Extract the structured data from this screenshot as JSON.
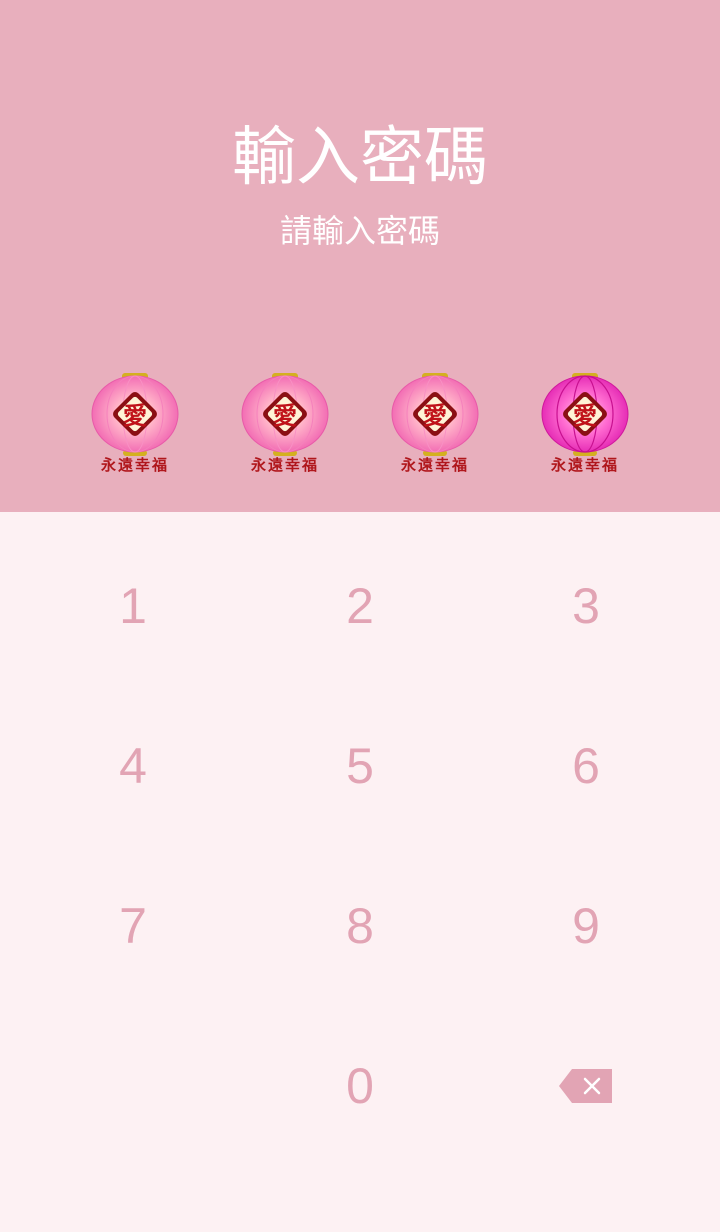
{
  "header": {
    "title": "輸入密碼",
    "subtitle": "請輸入密碼",
    "background_color": "#e8afbd"
  },
  "pin_indicators": [
    {
      "icon": "lantern-icon",
      "emblem": "愛",
      "caption": "永遠幸福",
      "filled": false
    },
    {
      "icon": "lantern-icon",
      "emblem": "愛",
      "caption": "永遠幸福",
      "filled": false
    },
    {
      "icon": "lantern-icon",
      "emblem": "愛",
      "caption": "永遠幸福",
      "filled": false
    },
    {
      "icon": "lantern-icon",
      "emblem": "愛",
      "caption": "永遠幸福",
      "filled": true
    }
  ],
  "keypad": {
    "keys": [
      "1",
      "2",
      "3",
      "4",
      "5",
      "6",
      "7",
      "8",
      "9",
      "",
      "0",
      "backspace-icon"
    ],
    "key_color": "#e2a4b4",
    "background_color": "#fdf1f3"
  }
}
